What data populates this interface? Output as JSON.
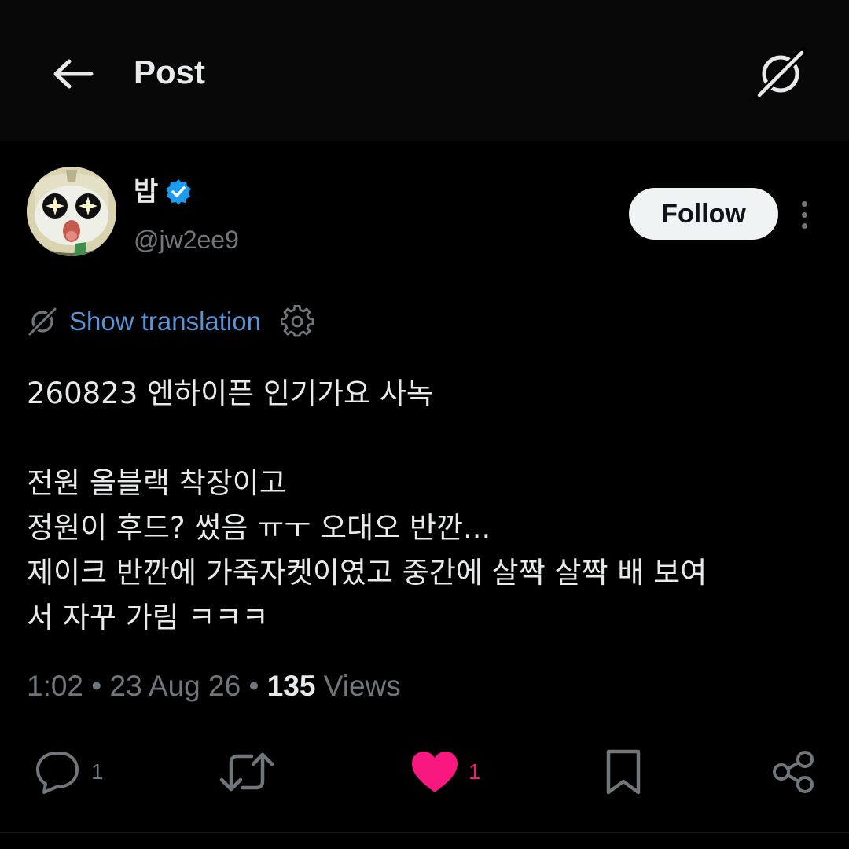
{
  "header": {
    "title": "Post",
    "back_icon": "arrow-left-icon",
    "grok_icon": "grok-icon"
  },
  "author": {
    "name": "밥",
    "handle": "@jw2ee9",
    "verified": true,
    "follow_label": "Follow"
  },
  "translation": {
    "label": "Show translation"
  },
  "post": {
    "lines": [
      "260823 엔하이픈 인기가요 사녹",
      "",
      "전원 올블랙 착장이고",
      "정원이 후드? 썼음 ㅠㅜ 오대오 반깐...",
      "제이크 반깐에 가죽자켓이였고 중간에 살짝 살짝 배 보여",
      "서 자꾸 가림 ㅋㅋㅋ"
    ]
  },
  "meta": {
    "time": "1:02",
    "separator": " • ",
    "date": "23 Aug 26",
    "views_count": "135",
    "views_label": " Views"
  },
  "actions": {
    "replies": "1",
    "reposts": "",
    "likes": "1",
    "like_color": "#f91880",
    "icon_color": "#71767b"
  },
  "colors": {
    "background": "#000000",
    "text": "#e7e9ea",
    "muted": "#71767b",
    "link": "#5a94d6",
    "verified": "#1d9bf0"
  }
}
